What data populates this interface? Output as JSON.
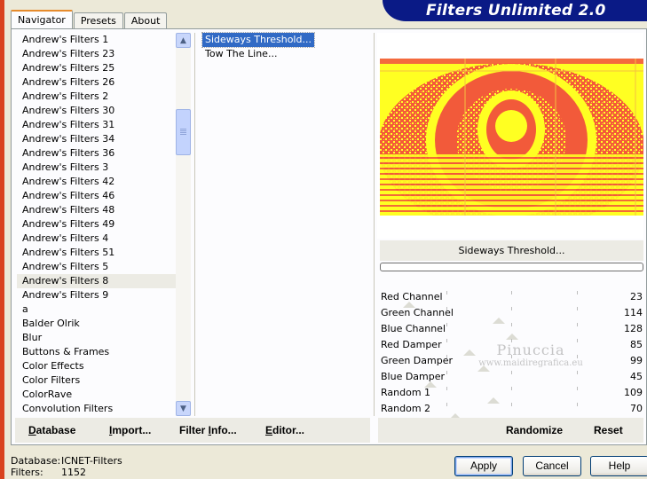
{
  "tabs": [
    "Navigator",
    "Presets",
    "About"
  ],
  "banner_title": "Filters Unlimited 2.0",
  "categories": [
    "Andrew's Filters 1",
    "Andrew's Filters 23",
    "Andrew's Filters 25",
    "Andrew's Filters 26",
    "Andrew's Filters 2",
    "Andrew's Filters 30",
    "Andrew's Filters 31",
    "Andrew's Filters 34",
    "Andrew's Filters 36",
    "Andrew's Filters 3",
    "Andrew's Filters 42",
    "Andrew's Filters 46",
    "Andrew's Filters 48",
    "Andrew's Filters 49",
    "Andrew's Filters 4",
    "Andrew's Filters 51",
    "Andrew's Filters 5",
    "Andrew's Filters 8",
    "Andrew's Filters 9",
    "a",
    "Balder Olrik",
    "Blur",
    "Buttons & Frames",
    "Color Effects",
    "Color Filters",
    "ColorRave",
    "Convolution Filters"
  ],
  "selected_category": "Andrew's Filters 8",
  "filters": [
    "Sideways Threshold...",
    "Tow The Line..."
  ],
  "selected_filter": "Sideways Threshold...",
  "current_filter_name": "Sideways Threshold...",
  "params": [
    {
      "name": "Red Channel",
      "value": "23",
      "level": 23
    },
    {
      "name": "Green Channel",
      "value": "114",
      "level": 114
    },
    {
      "name": "Blue Channel",
      "value": "128",
      "level": 128
    },
    {
      "name": "Red Damper",
      "value": "85",
      "level": 85
    },
    {
      "name": "Green Damper",
      "value": "99",
      "level": 99
    },
    {
      "name": "Blue Damper",
      "value": "45",
      "level": 45
    },
    {
      "name": "Random 1",
      "value": "109",
      "level": 109
    },
    {
      "name": "Random 2",
      "value": "70",
      "level": 70
    }
  ],
  "watermark": {
    "name": "Pinuccia",
    "url": "www.maidiregrafica.eu"
  },
  "left_buttons": [
    {
      "label": "Database",
      "ul": "D",
      "rest": "atabase"
    },
    {
      "label": "Import...",
      "ul": "I",
      "rest": "mport..."
    },
    {
      "label": "Filter Info...",
      "pre": "Filter ",
      "ul": "I",
      "rest": "nfo..."
    },
    {
      "label": "Editor...",
      "ul": "E",
      "rest": "ditor..."
    }
  ],
  "right_buttons": {
    "randomize": "Randomize",
    "reset": "Reset"
  },
  "status": {
    "database_label": "Database:",
    "database_value": "ICNET-Filters",
    "filters_label": "Filters:",
    "filters_value": "1152"
  },
  "dialog_buttons": {
    "apply": "Apply",
    "cancel": "Cancel",
    "help": "Help"
  },
  "colors": {
    "banner": "#0a1a86",
    "selection": "#316ac5",
    "preview_red": "#f25a3a",
    "preview_yellow": "#ffff1e"
  }
}
